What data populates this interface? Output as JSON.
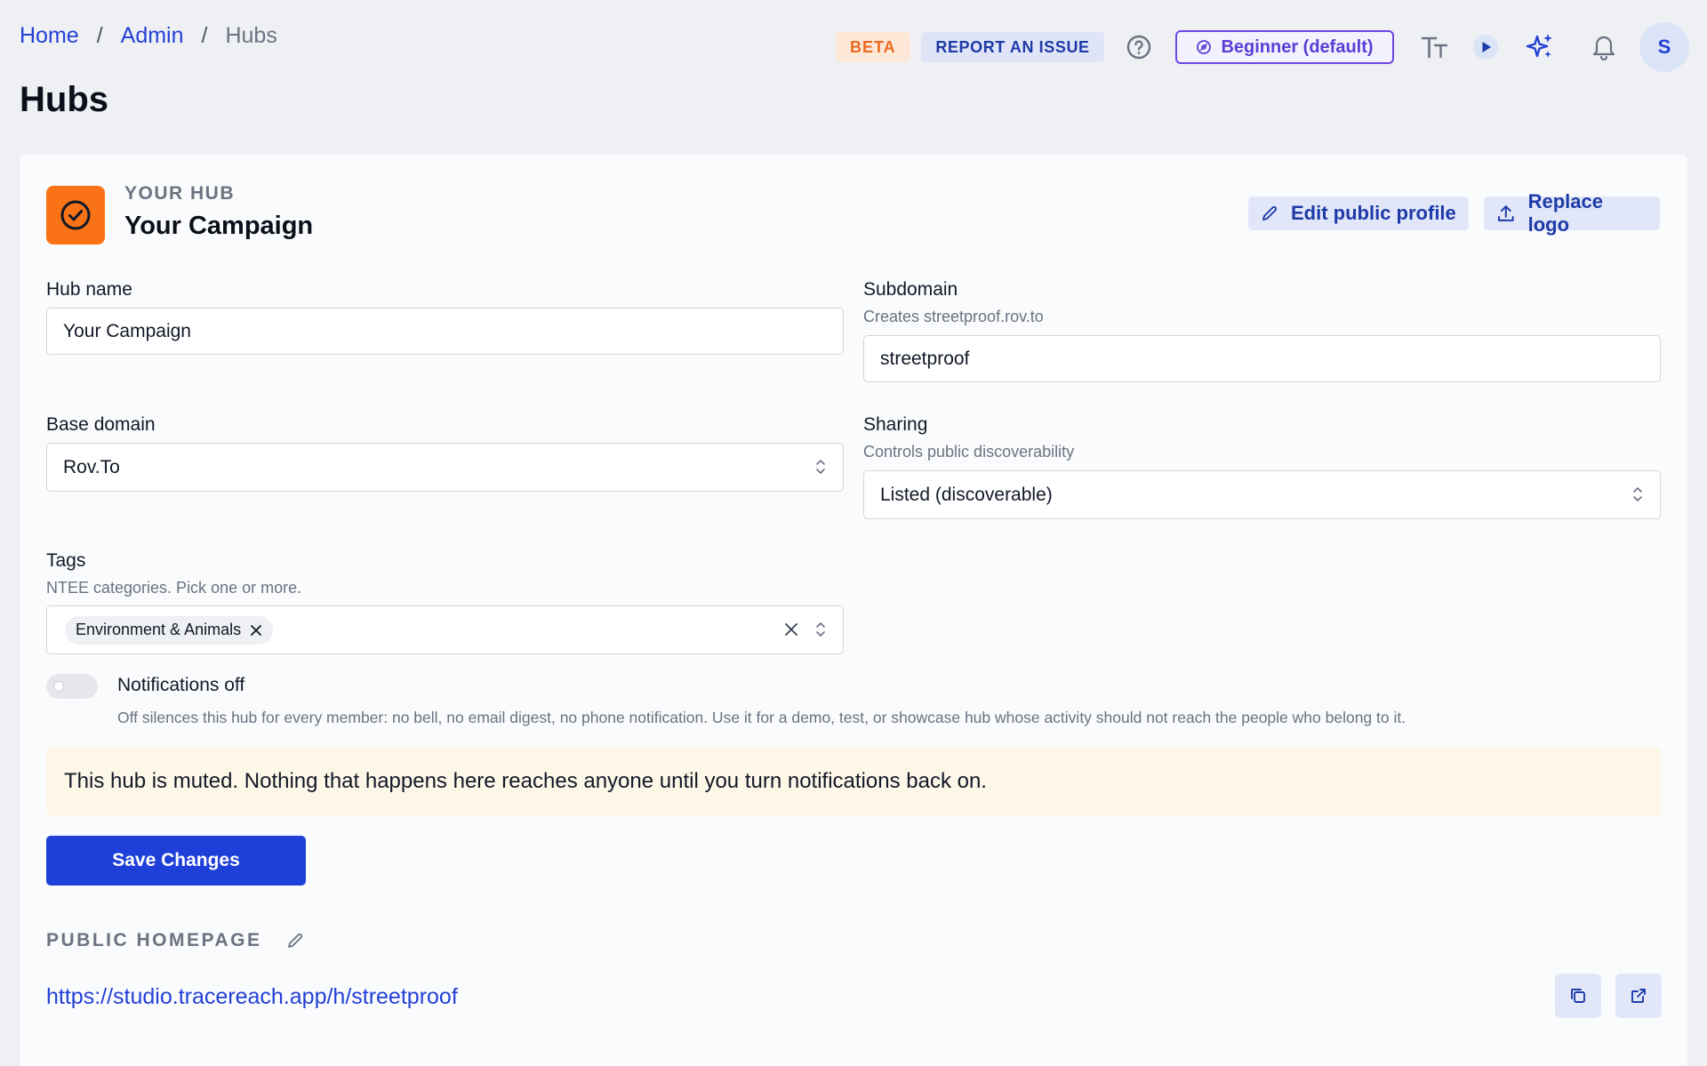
{
  "breadcrumb": {
    "home": "Home",
    "admin": "Admin",
    "current": "Hubs",
    "separator": "/"
  },
  "page": {
    "title": "Hubs"
  },
  "header": {
    "beta_label": "BETA",
    "report_label": "REPORT AN ISSUE",
    "level_label": "Beginner (default)",
    "avatar_initial": "S"
  },
  "hub": {
    "eyebrow": "YOUR HUB",
    "name": "Your Campaign",
    "edit_profile_label": "Edit public profile",
    "replace_logo_label": "Replace logo"
  },
  "form": {
    "hub_name_label": "Hub name",
    "hub_name_value": "Your Campaign",
    "subdomain_label": "Subdomain",
    "subdomain_help": "Creates streetproof.rov.to",
    "subdomain_value": "streetproof",
    "base_domain_label": "Base domain",
    "base_domain_value": "Rov.To",
    "sharing_label": "Sharing",
    "sharing_help": "Controls public discoverability",
    "sharing_value": "Listed (discoverable)",
    "tags_label": "Tags",
    "tags_help": "NTEE categories. Pick one or more.",
    "tags": [
      "Environment & Animals"
    ]
  },
  "notifications": {
    "enabled": false,
    "label": "Notifications off",
    "help": "Off silences this hub for every member: no bell, no email digest, no phone notification. Use it for a demo, test, or showcase hub whose activity should not reach the people who belong to it."
  },
  "banner": {
    "text": "This hub is muted. Nothing that happens here reaches anyone until you turn notifications back on."
  },
  "actions": {
    "save_label": "Save Changes"
  },
  "public_homepage": {
    "heading": "PUBLIC HOMEPAGE",
    "url": "https://studio.tracereach.app/h/streetproof"
  },
  "colors": {
    "primary": "#1e3fd8",
    "link": "#2341d6",
    "hub_logo": "#f97316",
    "beta": "#ea6a1e",
    "level_accent": "#6b46e0",
    "banner_bg": "#fdf7e7"
  },
  "icons": [
    "help-icon",
    "gauge-icon",
    "text-size-icon",
    "play-icon",
    "sparkle-icon",
    "bell-icon",
    "check-circle-icon",
    "pencil-icon",
    "upload-icon",
    "chevron-updown-icon",
    "close-icon",
    "copy-icon",
    "external-link-icon"
  ]
}
